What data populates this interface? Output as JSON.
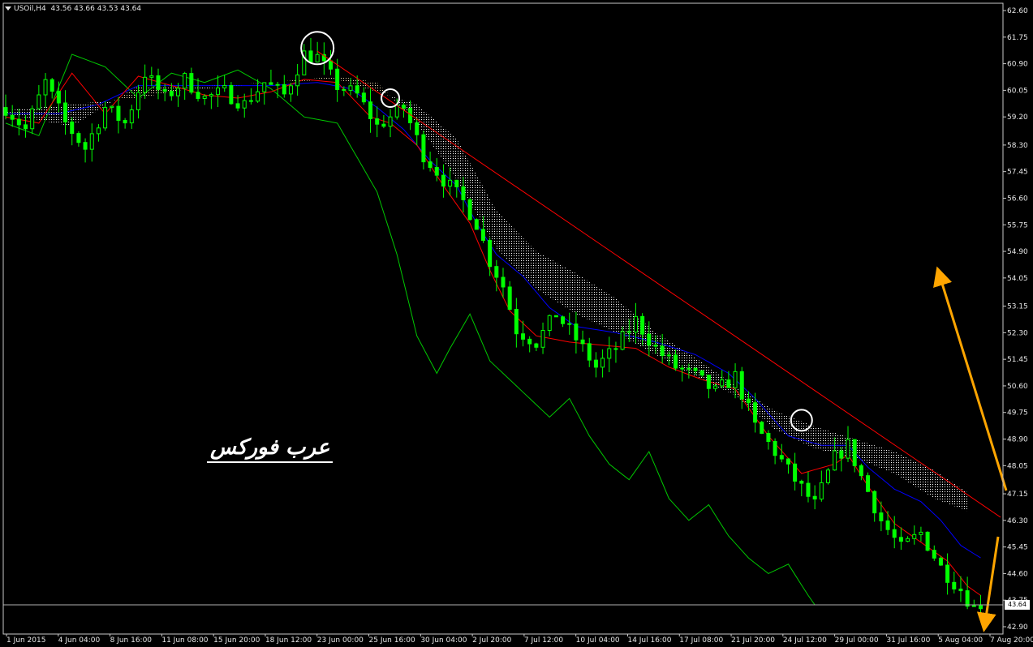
{
  "header": {
    "symbol": "USOil,H4",
    "ohlc": "43.56 43.66 43.53 43.64"
  },
  "watermark": "عرب فوركس",
  "current_price_label": "43.64",
  "colors": {
    "background": "#000000",
    "candles": "#00ff00",
    "chikou": "#00c800",
    "tenkan": "#ff0000",
    "kijun": "#0000ff",
    "cloud_bear": "#ffffff",
    "cloud_bull": "#f5deb3",
    "trendline": "#ff0000",
    "arrows": "#ffa500",
    "circles": "#ffffff",
    "text": "#e6e6e6"
  },
  "chart_data": {
    "type": "candlestick",
    "title": "USOil,H4",
    "y_ticks": [
      "62.60",
      "61.75",
      "60.90",
      "60.05",
      "59.20",
      "58.30",
      "57.45",
      "56.60",
      "55.75",
      "54.90",
      "54.05",
      "53.15",
      "52.30",
      "51.45",
      "50.60",
      "49.75",
      "48.90",
      "48.05",
      "47.15",
      "46.30",
      "45.45",
      "44.60",
      "43.75",
      "42.90"
    ],
    "ylim": [
      42.9,
      62.6
    ],
    "x_ticks": [
      "1 Jun 2015",
      "4 Jun 04:00",
      "8 Jun 16:00",
      "11 Jun 08:00",
      "15 Jun 20:00",
      "18 Jun 12:00",
      "23 Jun 00:00",
      "25 Jun 16:00",
      "30 Jun 04:00",
      "2 Jul 20:00",
      "7 Jul 12:00",
      "10 Jul 04:00",
      "14 Jul 16:00",
      "17 Jul 08:00",
      "21 Jul 20:00",
      "24 Jul 12:00",
      "29 Jul 00:00",
      "31 Jul 16:00",
      "5 Aug 04:00",
      "7 Aug 20:00"
    ],
    "price_path": [
      [
        0,
        59.5
      ],
      [
        3,
        58.8
      ],
      [
        6,
        60.3
      ],
      [
        9,
        59.0
      ],
      [
        12,
        58.2
      ],
      [
        15,
        59.5
      ],
      [
        18,
        59.0
      ],
      [
        21,
        60.6
      ],
      [
        24,
        59.8
      ],
      [
        27,
        60.4
      ],
      [
        30,
        59.8
      ],
      [
        33,
        60.0
      ],
      [
        36,
        59.6
      ],
      [
        39,
        60.3
      ],
      [
        42,
        59.9
      ],
      [
        45,
        61.2
      ],
      [
        47,
        61.1
      ],
      [
        50,
        60.2
      ],
      [
        53,
        59.9
      ],
      [
        56,
        58.9
      ],
      [
        60,
        59.5
      ],
      [
        63,
        58.0
      ],
      [
        66,
        57.2
      ],
      [
        69,
        56.5
      ],
      [
        71,
        55.8
      ],
      [
        73,
        54.6
      ],
      [
        75,
        53.8
      ],
      [
        77,
        52.4
      ],
      [
        80,
        52.0
      ],
      [
        83,
        52.9
      ],
      [
        86,
        52.1
      ],
      [
        89,
        51.2
      ],
      [
        92,
        51.8
      ],
      [
        95,
        52.7
      ],
      [
        98,
        51.8
      ],
      [
        101,
        51.2
      ],
      [
        104,
        50.9
      ],
      [
        107,
        50.4
      ],
      [
        110,
        50.9
      ],
      [
        113,
        49.3
      ],
      [
        116,
        48.5
      ],
      [
        119,
        47.6
      ],
      [
        122,
        46.8
      ],
      [
        125,
        48.3
      ],
      [
        127,
        48.7
      ],
      [
        129,
        47.7
      ],
      [
        132,
        46.3
      ],
      [
        135,
        45.4
      ],
      [
        138,
        45.9
      ],
      [
        141,
        44.8
      ],
      [
        144,
        44.1
      ],
      [
        146,
        43.5
      ],
      [
        147,
        43.64
      ]
    ],
    "tenkan_path": [
      [
        0,
        59.2
      ],
      [
        5,
        59.0
      ],
      [
        10,
        60.6
      ],
      [
        15,
        59.3
      ],
      [
        20,
        60.5
      ],
      [
        25,
        60.2
      ],
      [
        30,
        59.9
      ],
      [
        35,
        59.8
      ],
      [
        40,
        60.0
      ],
      [
        45,
        60.4
      ],
      [
        50,
        60.3
      ],
      [
        55,
        59.2
      ],
      [
        58,
        59.0
      ],
      [
        62,
        58.3
      ],
      [
        66,
        57.0
      ],
      [
        70,
        55.8
      ],
      [
        73,
        54.3
      ],
      [
        76,
        53.0
      ],
      [
        80,
        52.2
      ],
      [
        85,
        52.0
      ],
      [
        90,
        51.9
      ],
      [
        95,
        51.8
      ],
      [
        100,
        51.2
      ],
      [
        105,
        50.8
      ],
      [
        110,
        50.5
      ],
      [
        115,
        49.0
      ],
      [
        120,
        47.8
      ],
      [
        125,
        48.1
      ],
      [
        127,
        48.4
      ],
      [
        130,
        47.4
      ],
      [
        134,
        46.2
      ],
      [
        138,
        45.6
      ],
      [
        142,
        45.0
      ],
      [
        145,
        44.2
      ],
      [
        147,
        43.9
      ]
    ],
    "kijun_path": [
      [
        0,
        59.3
      ],
      [
        8,
        59.3
      ],
      [
        14,
        59.6
      ],
      [
        20,
        60.2
      ],
      [
        30,
        60.2
      ],
      [
        40,
        60.2
      ],
      [
        47,
        60.3
      ],
      [
        52,
        60.1
      ],
      [
        56,
        59.5
      ],
      [
        60,
        58.8
      ],
      [
        64,
        57.8
      ],
      [
        68,
        57.0
      ],
      [
        71,
        55.8
      ],
      [
        74,
        54.8
      ],
      [
        78,
        54.1
      ],
      [
        82,
        53.1
      ],
      [
        86,
        52.5
      ],
      [
        92,
        52.3
      ],
      [
        98,
        52.0
      ],
      [
        104,
        51.6
      ],
      [
        109,
        51.0
      ],
      [
        113,
        50.2
      ],
      [
        118,
        49.0
      ],
      [
        123,
        48.7
      ],
      [
        127,
        48.7
      ],
      [
        130,
        48.0
      ],
      [
        134,
        47.3
      ],
      [
        138,
        46.9
      ],
      [
        141,
        46.3
      ],
      [
        144,
        45.5
      ],
      [
        147,
        45.1
      ]
    ],
    "chikou_path": [
      [
        0,
        59.0
      ],
      [
        5,
        58.6
      ],
      [
        10,
        61.2
      ],
      [
        15,
        60.8
      ],
      [
        20,
        59.8
      ],
      [
        25,
        60.6
      ],
      [
        30,
        60.3
      ],
      [
        35,
        60.7
      ],
      [
        40,
        60.1
      ],
      [
        45,
        59.2
      ],
      [
        50,
        59.0
      ],
      [
        53,
        57.9
      ],
      [
        56,
        56.8
      ],
      [
        59,
        54.8
      ],
      [
        62,
        52.2
      ],
      [
        65,
        51.0
      ],
      [
        67,
        51.8
      ],
      [
        70,
        52.9
      ],
      [
        73,
        51.4
      ],
      [
        76,
        50.8
      ],
      [
        79,
        50.2
      ],
      [
        82,
        49.6
      ],
      [
        85,
        50.2
      ],
      [
        88,
        49.0
      ],
      [
        91,
        48.1
      ],
      [
        94,
        47.6
      ],
      [
        97,
        48.5
      ],
      [
        100,
        47.0
      ],
      [
        103,
        46.3
      ],
      [
        106,
        46.8
      ],
      [
        109,
        45.8
      ],
      [
        112,
        45.1
      ],
      [
        115,
        44.6
      ],
      [
        118,
        44.9
      ],
      [
        121,
        43.9
      ],
      [
        122,
        43.6
      ]
    ],
    "cloud_senkou_a": [
      [
        0,
        59.3
      ],
      [
        10,
        58.9
      ],
      [
        20,
        60.2
      ],
      [
        30,
        60.1
      ],
      [
        40,
        60.3
      ],
      [
        50,
        60.5
      ],
      [
        56,
        60.3
      ],
      [
        62,
        59.0
      ],
      [
        68,
        57.2
      ],
      [
        74,
        55.0
      ],
      [
        80,
        53.7
      ],
      [
        86,
        52.9
      ],
      [
        92,
        52.3
      ],
      [
        98,
        51.6
      ],
      [
        104,
        50.9
      ],
      [
        110,
        50.3
      ],
      [
        116,
        49.2
      ],
      [
        122,
        48.6
      ],
      [
        128,
        48.3
      ],
      [
        134,
        47.8
      ],
      [
        140,
        47.0
      ],
      [
        145,
        46.6
      ]
    ],
    "cloud_senkou_b": [
      [
        0,
        59.4
      ],
      [
        10,
        59.6
      ],
      [
        20,
        59.8
      ],
      [
        30,
        60.2
      ],
      [
        40,
        60.3
      ],
      [
        50,
        60.4
      ],
      [
        56,
        60.0
      ],
      [
        62,
        59.6
      ],
      [
        68,
        58.5
      ],
      [
        74,
        56.2
      ],
      [
        80,
        54.9
      ],
      [
        86,
        54.2
      ],
      [
        92,
        53.4
      ],
      [
        98,
        52.3
      ],
      [
        104,
        51.5
      ],
      [
        110,
        50.6
      ],
      [
        116,
        49.8
      ],
      [
        122,
        49.3
      ],
      [
        128,
        48.9
      ],
      [
        134,
        48.5
      ],
      [
        140,
        47.9
      ],
      [
        145,
        47.2
      ]
    ],
    "trendline": [
      [
        47,
        61.3
      ],
      [
        150,
        46.4
      ]
    ],
    "circled_points": [
      [
        47,
        61.4
      ],
      [
        58,
        59.8
      ],
      [
        120,
        49.5
      ]
    ],
    "annotations": []
  }
}
